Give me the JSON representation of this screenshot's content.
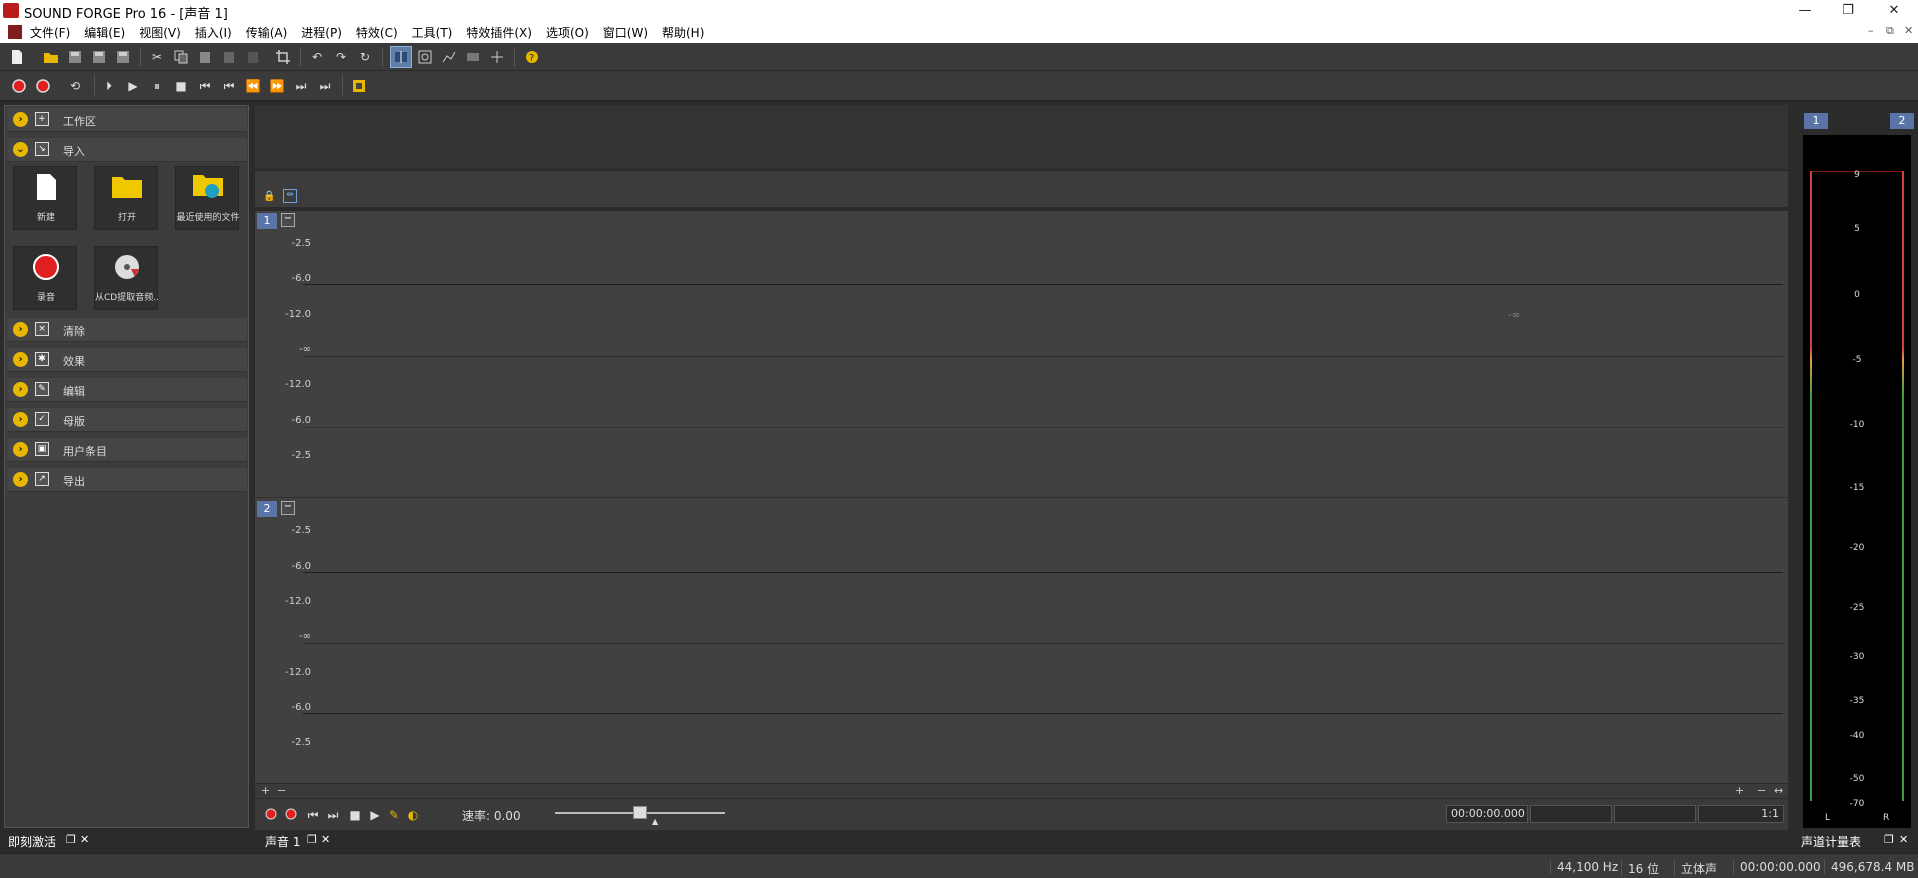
{
  "window": {
    "title": "SOUND FORGE Pro 16 - [声音 1]",
    "minimize": "—",
    "maximize": "❐",
    "close": "✕"
  },
  "menu": [
    "文件(F)",
    "编辑(E)",
    "视图(V)",
    "插入(I)",
    "传输(A)",
    "进程(P)",
    "特效(C)",
    "工具(T)",
    "特效插件(X)",
    "选项(O)",
    "窗口(W)",
    "帮助(H)"
  ],
  "mdi": {
    "minimize": "–",
    "restore": "⧉",
    "close": "✕"
  },
  "left_pane": {
    "sections": [
      {
        "label": "工作区",
        "icon": "workspace-icon",
        "expanded": false
      },
      {
        "label": "导入",
        "icon": "import-icon",
        "expanded": true
      },
      {
        "label": "清除",
        "icon": "clean-icon",
        "expanded": false
      },
      {
        "label": "效果",
        "icon": "effects-icon",
        "expanded": false
      },
      {
        "label": "编辑",
        "icon": "edit-icon",
        "expanded": false
      },
      {
        "label": "母版",
        "icon": "master-icon",
        "expanded": false
      },
      {
        "label": "用户条目",
        "icon": "user-items-icon",
        "expanded": false
      },
      {
        "label": "导出",
        "icon": "export-icon",
        "expanded": false
      }
    ],
    "import_tiles": [
      {
        "label": "新建",
        "icon": "new-file-icon"
      },
      {
        "label": "打开",
        "icon": "open-folder-icon"
      },
      {
        "label": "最近使用的文件",
        "icon": "recent-files-icon"
      },
      {
        "label": "录音",
        "icon": "record-icon"
      },
      {
        "label": "从CD提取音频...",
        "icon": "cd-extract-icon"
      }
    ],
    "tab_label": "即刻激活"
  },
  "document": {
    "tab_label": "声音 1",
    "channels": [
      {
        "number": "1",
        "db_labels": [
          "-2.5",
          "-6.0",
          "-12.0",
          "-∞",
          "-12.0",
          "-6.0",
          "-2.5"
        ]
      },
      {
        "number": "2",
        "db_labels": [
          "-2.5",
          "-6.0",
          "-12.0",
          "-∞",
          "-12.0",
          "-6.0",
          "-2.5"
        ]
      }
    ],
    "zoom_in": "+",
    "zoom_out": "−",
    "rate_label": "速率: 0.00",
    "cursor_time": "00:00:00.000",
    "zoom_ratio": "1:1"
  },
  "meter": {
    "title": "声道计量表",
    "channel_badges": [
      "1",
      "2"
    ],
    "peak_readout": "-∞",
    "scale": [
      "9",
      "5",
      "0",
      "-5",
      "-10",
      "-15",
      "-20",
      "-25",
      "-30",
      "-35",
      "-40",
      "-50",
      "-70"
    ],
    "lr_labels": [
      "L",
      "R"
    ]
  },
  "status": {
    "sample_rate": "44,100 Hz",
    "bit_depth": "16 位",
    "channels": "立体声",
    "length": "00:00:00.000",
    "memory": "496,678.4 MB"
  },
  "colors": {
    "accent_blue": "#5b74a8",
    "section_icon_yellow": "#e8b800",
    "record_red": "#e02020"
  }
}
